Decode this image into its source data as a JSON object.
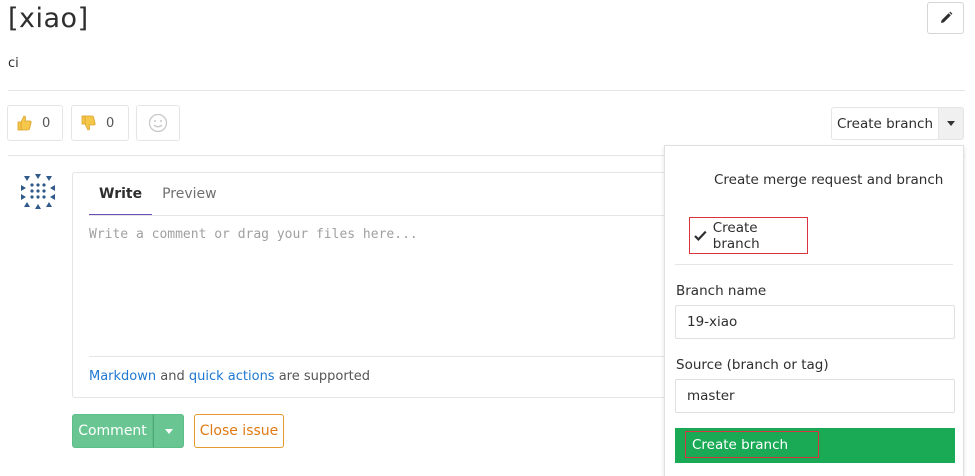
{
  "issue": {
    "title": "[xiao]",
    "description": "ci"
  },
  "awards": {
    "thumbs_up_count": "0",
    "thumbs_down_count": "0"
  },
  "create_branch_button": {
    "label": "Create branch"
  },
  "comment_form": {
    "tabs": [
      {
        "label": "Write",
        "active": true
      },
      {
        "label": "Preview",
        "active": false
      }
    ],
    "placeholder": "Write a comment or drag your files here...",
    "hint_link1": "Markdown",
    "hint_text1": " and ",
    "hint_link2": "quick actions",
    "hint_text2": " are supported",
    "comment_label": "Comment",
    "close_label": "Close issue"
  },
  "dropdown": {
    "option_merge_request": "Create merge request and branch",
    "option_branch": "Create branch",
    "branch_name_label": "Branch name",
    "branch_name_value": "19-xiao",
    "source_label": "Source (branch or tag)",
    "source_value": "master",
    "submit_label": "Create branch"
  },
  "colors": {
    "accent_tab": "#6b4fbb",
    "comment_green": "#69c693",
    "submit_green": "#1aaa55",
    "close_orange": "#e07a14",
    "highlight_red": "#d8343f",
    "link_blue": "#1f78d1"
  }
}
